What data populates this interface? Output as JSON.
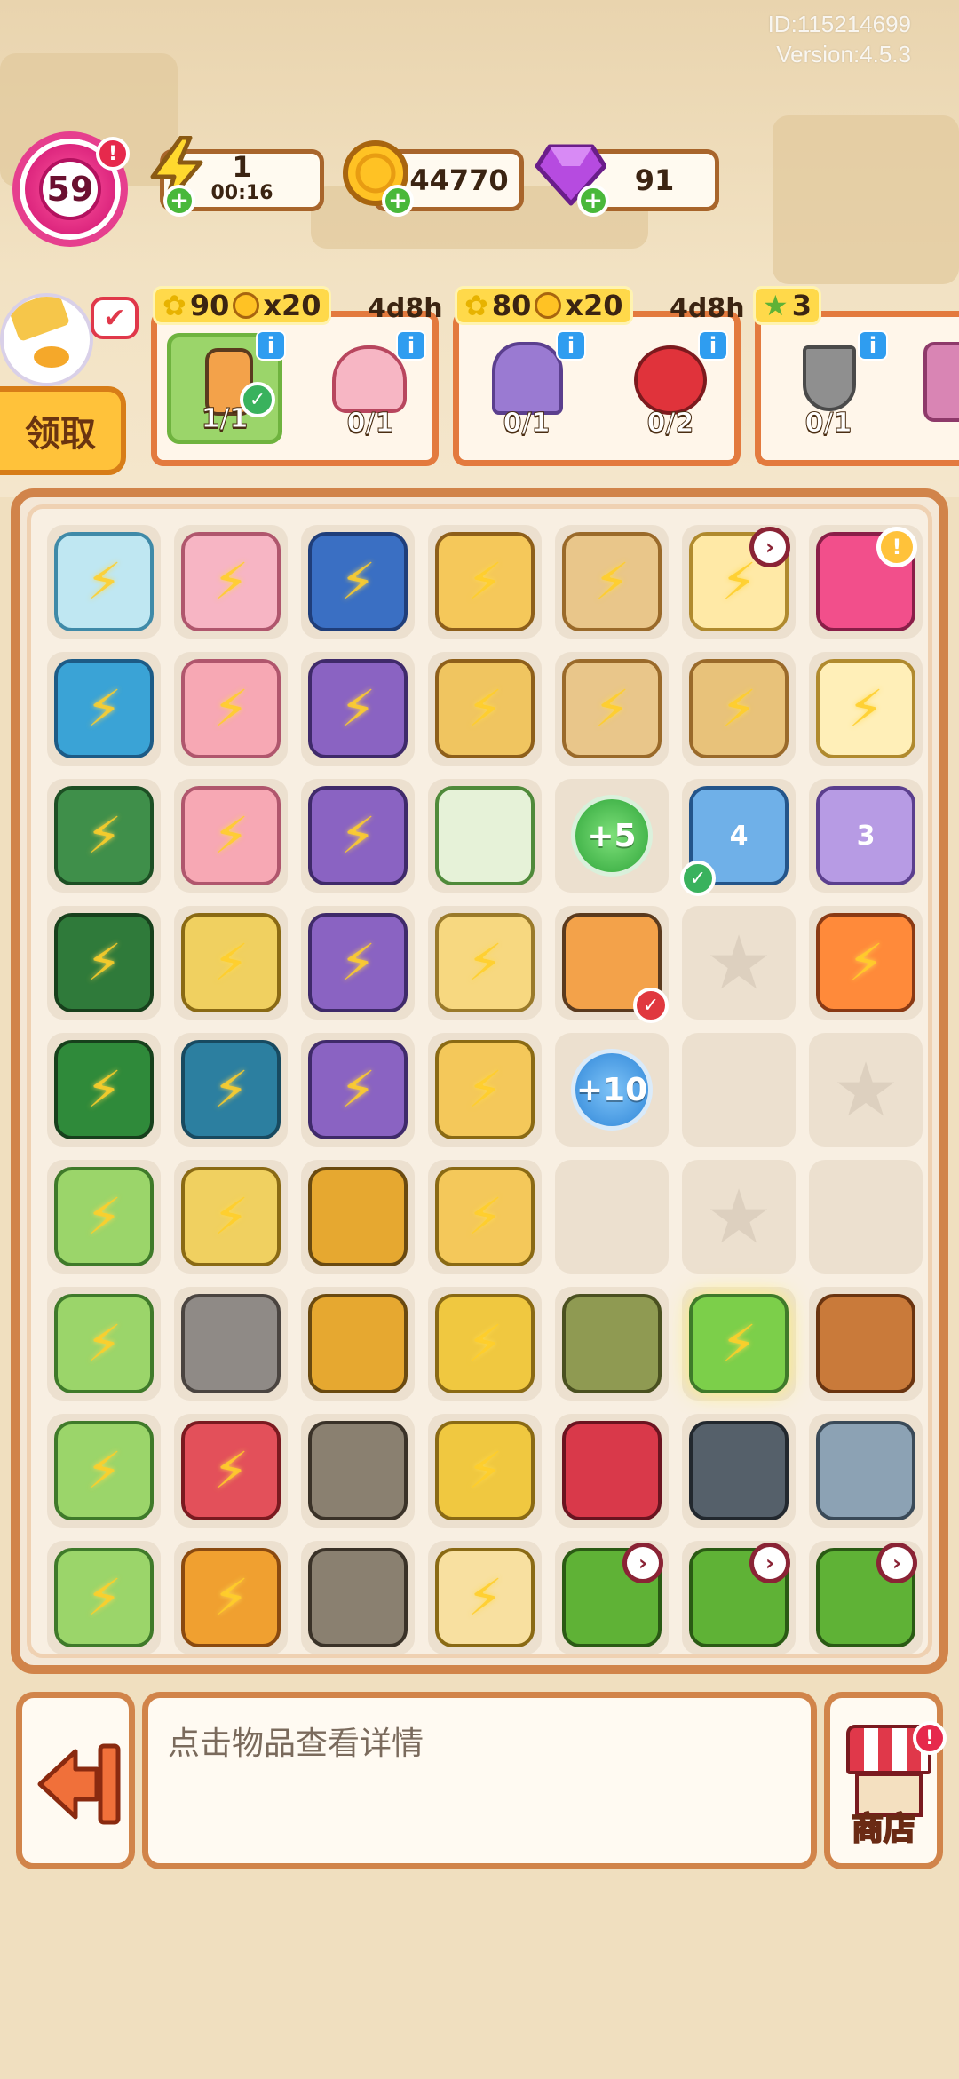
{
  "meta": {
    "id": "ID:115214699",
    "version": "Version:4.5.3"
  },
  "header": {
    "level": "59",
    "energy": {
      "value": "1",
      "timer": "00:16"
    },
    "coins": "44770",
    "gems": "91"
  },
  "orders": {
    "claim_label": "领取",
    "cards": [
      {
        "flower": "90",
        "coin": "x20",
        "time": "4d8h",
        "slots": [
          "1/1",
          "0/1"
        ]
      },
      {
        "flower": "80",
        "coin": "x20",
        "time": "4d8h",
        "slots": [
          "0/1",
          "0/2"
        ]
      },
      {
        "star": "3",
        "slots": [
          "0/1"
        ]
      }
    ]
  },
  "board": {
    "bubble_plus5": "+5",
    "bubble_plus10": "+10",
    "book_4": "4",
    "book_3": "3"
  },
  "footer": {
    "detail_placeholder": "点击物品查看详情",
    "shop_label": "商店"
  },
  "colors": {
    "accent": "#d1844a",
    "order_border": "#e37a3e",
    "energy": "#ffd92e",
    "gem": "#b64be0"
  }
}
